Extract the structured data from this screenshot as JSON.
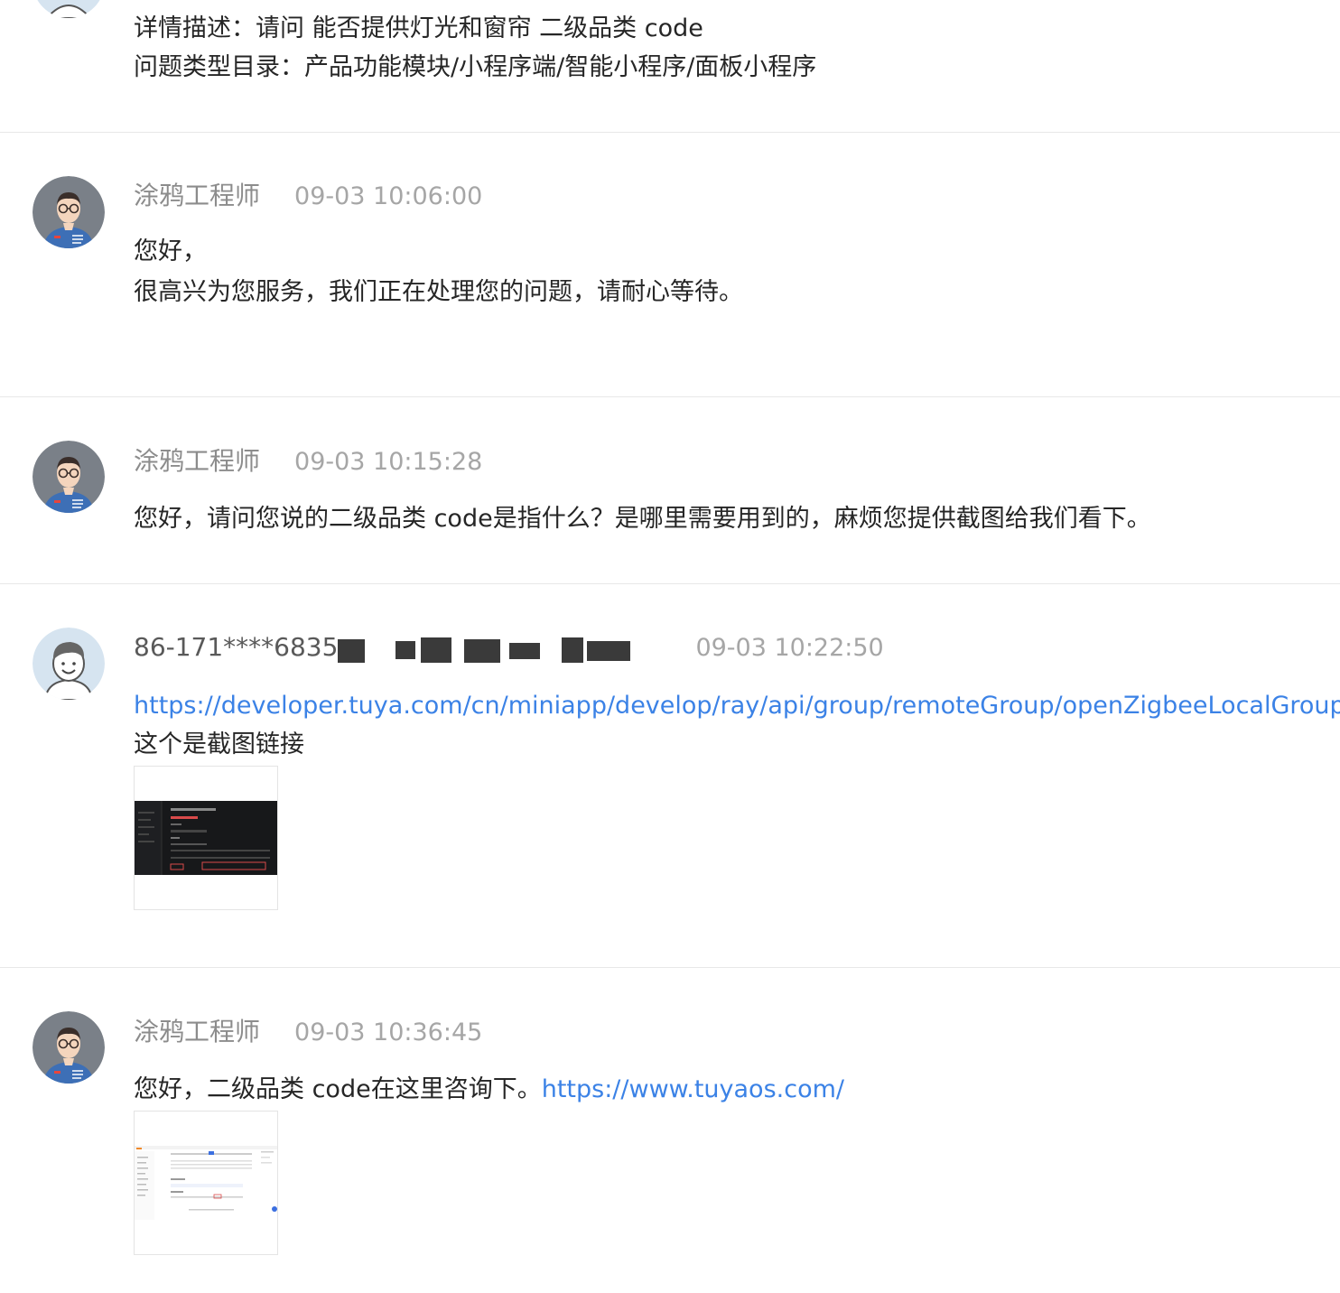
{
  "first_message": {
    "detail_line": "详情描述：请问 能否提供灯光和窗帘 二级品类 code",
    "category_line": "问题类型目录：产品功能模块/小程序端/智能小程序/面板小程序"
  },
  "messages": [
    {
      "sender": "涂鸦工程师",
      "time": "09-03 10:06:00",
      "lines": [
        "您好，",
        "很高兴为您服务，我们正在处理您的问题，请耐心等待。"
      ]
    },
    {
      "sender": "涂鸦工程师",
      "time": "09-03 10:15:28",
      "lines": [
        "您好，请问您说的二级品类 code是指什么？是哪里需要用到的，麻烦您提供截图给我们看下。"
      ]
    },
    {
      "sender": "86-171****6835",
      "time": "09-03 10:22:50",
      "link": "https://developer.tuya.com/cn/miniapp/develop/ray/api/group/remoteGroup/openZigbeeLocalGroup",
      "lines": [
        "这个是截图链接"
      ]
    },
    {
      "sender": "涂鸦工程师",
      "time": "09-03 10:36:45",
      "text_before_link": "您好，二级品类 code在这里咨询下。",
      "link": "https://www.tuyaos.com/"
    }
  ],
  "icons": {
    "engineer_avatar": "engineer-avatar-icon",
    "user_avatar": "user-avatar-icon"
  },
  "colors": {
    "link": "#3b82e6",
    "divider": "#e8e8e8",
    "meta_text": "#8c8c8c"
  }
}
